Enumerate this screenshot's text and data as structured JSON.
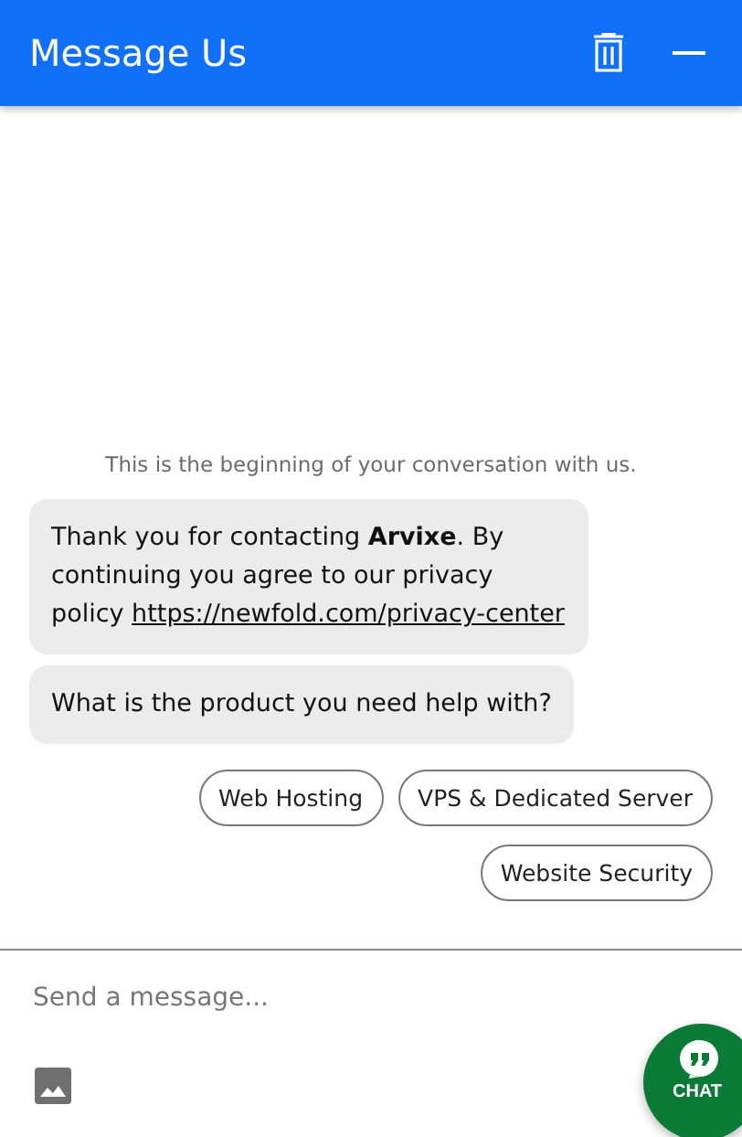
{
  "header": {
    "title": "Message Us"
  },
  "notice": "This is the beginning of your conversation with us.",
  "messages": [
    {
      "text": "Thank you for contacting **Arvixe**. By continuing you agree to our privacy policy",
      "link": "https://newfold.com/privacy-center"
    },
    {
      "text": "What is the product you need help with?"
    }
  ],
  "quick_replies": [
    "Web Hosting",
    "VPS & Dedicated Server",
    "Website Security"
  ],
  "composer": {
    "placeholder": "Send a message..."
  },
  "chat_button": {
    "label": "CHAT"
  }
}
